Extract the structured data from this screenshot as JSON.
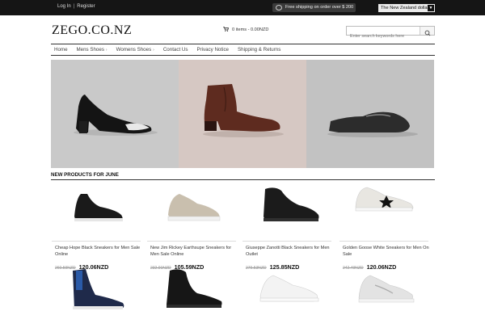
{
  "topbar": {
    "login": "Log In",
    "separator": "|",
    "register": "Register",
    "shipping": "Free shipping on order over $ 200",
    "currency": "The New Zealand dollar"
  },
  "header": {
    "logo": "ZEGO.CO.NZ",
    "cart": "0 items - 0.00NZD",
    "search_placeholder": "Enter search keywords here"
  },
  "nav": {
    "items": [
      {
        "label": "Home"
      },
      {
        "label": "Mens Shoes"
      },
      {
        "label": "Womens Shoes"
      },
      {
        "label": "Contact Us"
      },
      {
        "label": "Privacy Notice"
      },
      {
        "label": "Shipping & Returns"
      }
    ]
  },
  "section": {
    "title": "NEW PRODUCTS FOR JUNE"
  },
  "products": [
    {
      "name": "Cheap Hope Black Sneakers for Men Sale Online",
      "old_price": "260.59NZD",
      "price": "120.06NZD"
    },
    {
      "name": "New Jim Rickey Earthsupe Sneakers for Men Sale Online",
      "old_price": "232.91NZD",
      "price": "105.59NZD"
    },
    {
      "name": "Giuseppe Zanotti Black Sneakers for Men Outlet",
      "old_price": "279.53NZD",
      "price": "125.85NZD"
    },
    {
      "name": "Golden Goose White Sneakers for Men On Sale",
      "old_price": "242.49NZD",
      "price": "120.06NZD"
    },
    {
      "name": "",
      "old_price": "",
      "price": ""
    },
    {
      "name": "",
      "old_price": "",
      "price": ""
    },
    {
      "name": "",
      "old_price": "",
      "price": ""
    },
    {
      "name": "",
      "old_price": "",
      "price": ""
    }
  ],
  "colors": {
    "topbar_bg": "#151515",
    "accent_dark": "#111111",
    "banner_left": "#c9c9c9",
    "banner_mid": "#d6c8c3",
    "banner_right": "#c2c2c2"
  }
}
